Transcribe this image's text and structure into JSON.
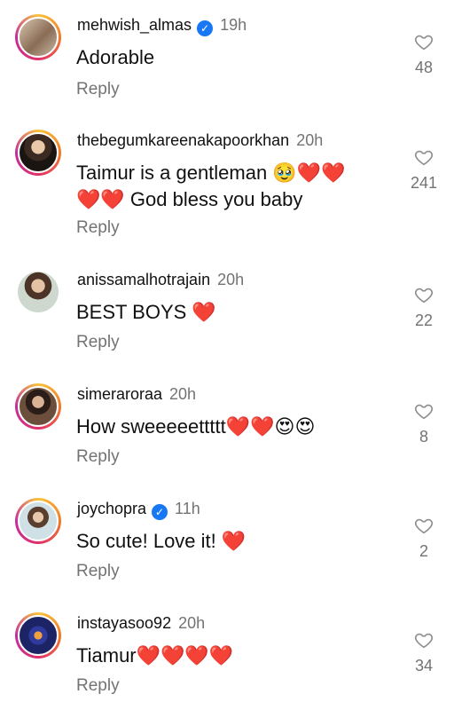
{
  "comments": [
    {
      "username": "mehwish_almas",
      "verified": true,
      "time": "19h",
      "text": "Adorable",
      "reply": "Reply",
      "likes": "48"
    },
    {
      "username": "thebegumkareenakapoorkhan",
      "verified": false,
      "time": "20h",
      "text_line1": "Taimur is a gentleman 🥹❤️❤️",
      "text_line2": "❤️❤️ God bless you baby",
      "reply": "Reply",
      "likes": "241"
    },
    {
      "username": "anissamalhotrajain",
      "verified": false,
      "time": "20h",
      "text": "BEST BOYS ❤️",
      "reply": "Reply",
      "likes": "22"
    },
    {
      "username": "simeraroraa",
      "verified": false,
      "time": "20h",
      "text": "How sweeeeettttt❤️❤️😍😍",
      "reply": "Reply",
      "likes": "8"
    },
    {
      "username": "joychopra",
      "verified": true,
      "time": "11h",
      "text": "So cute! Love it! ❤️",
      "reply": "Reply",
      "likes": "2"
    },
    {
      "username": "instayasoo92",
      "verified": false,
      "time": "20h",
      "text": "Tiamur❤️❤️❤️❤️",
      "reply": "Reply",
      "likes": "34"
    }
  ],
  "icons": {
    "like": "heart-outline-icon",
    "verified": "verified-badge-icon"
  },
  "colors": {
    "verified": "#1877f2",
    "meta_text": "#737373",
    "story_ring": "#e0306b"
  }
}
